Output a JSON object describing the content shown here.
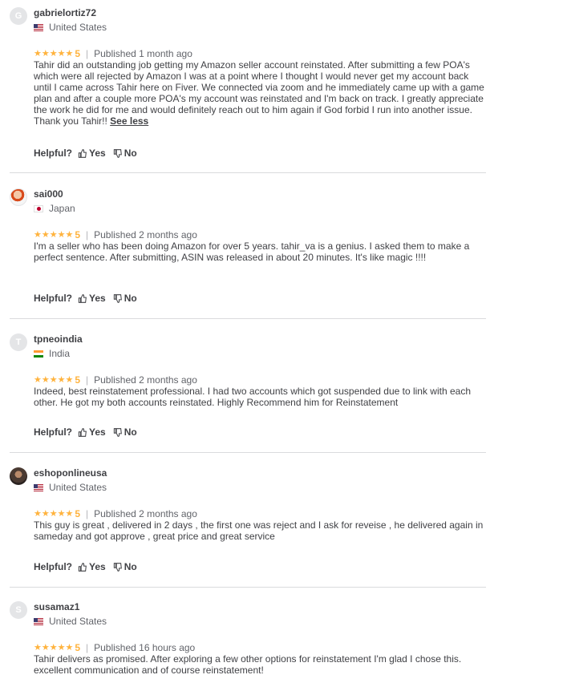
{
  "reviews": [
    {
      "avatar_letter": "G",
      "username": "gabrielortiz72",
      "country": "United States",
      "flag": "us",
      "stars": "★★★★★",
      "score": "5",
      "published": "Published 1 month ago",
      "text": "Tahir did an outstanding job getting my Amazon seller account reinstated. After submitting a few POA's which were all rejected by Amazon I was at a point where I thought I would never get my account back until I came across Tahir here on Fiver. We connected via zoom and he immediately came up with a game plan and after a couple more POA's my account was reinstated and I'm back on track. I greatly appreciate the work he did for me and would definitely reach out to him again if God forbid I run into another issue. Thank you Tahir!!",
      "see_less": "See less",
      "helpful_label": "Helpful?",
      "yes_label": "Yes",
      "no_label": "No"
    },
    {
      "avatar_letter": "",
      "username": "sai000",
      "country": "Japan",
      "flag": "jp",
      "stars": "★★★★★",
      "score": "5",
      "published": "Published 2 months ago",
      "text": "I'm a seller who has been doing Amazon for over 5 years. tahir_va is a genius. I asked them to make a perfect sentence. After submitting, ASIN was released in about 20 minutes. It's like magic !!!!",
      "see_less": "",
      "helpful_label": "Helpful?",
      "yes_label": "Yes",
      "no_label": "No"
    },
    {
      "avatar_letter": "T",
      "username": "tpneoindia",
      "country": "India",
      "flag": "in",
      "stars": "★★★★★",
      "score": "5",
      "published": "Published 2 months ago",
      "text": "Indeed, best reinstatement professional. I had two accounts which got suspended due to link with each other. He got my both accounts reinstated. Highly Recommend him for Reinstatement",
      "see_less": "",
      "helpful_label": "Helpful?",
      "yes_label": "Yes",
      "no_label": "No"
    },
    {
      "avatar_letter": "",
      "username": "eshoponlineusa",
      "country": "United States",
      "flag": "us",
      "stars": "★★★★★",
      "score": "5",
      "published": "Published 2 months ago",
      "text": "This guy is great , delivered in 2 days , the first one was reject and I ask for reveise , he delivered again in sameday and got approve , great price and great service",
      "see_less": "",
      "helpful_label": "Helpful?",
      "yes_label": "Yes",
      "no_label": "No"
    },
    {
      "avatar_letter": "S",
      "username": "susamaz1",
      "country": "United States",
      "flag": "us",
      "stars": "★★★★★",
      "score": "5",
      "published": "Published 16 hours ago",
      "text": "Tahir delivers as promised. After exploring a few other options for reinstatement I'm glad I chose this. excellent communication and of course reinstatement!",
      "see_less": "",
      "helpful_label": "",
      "yes_label": "",
      "no_label": ""
    }
  ]
}
